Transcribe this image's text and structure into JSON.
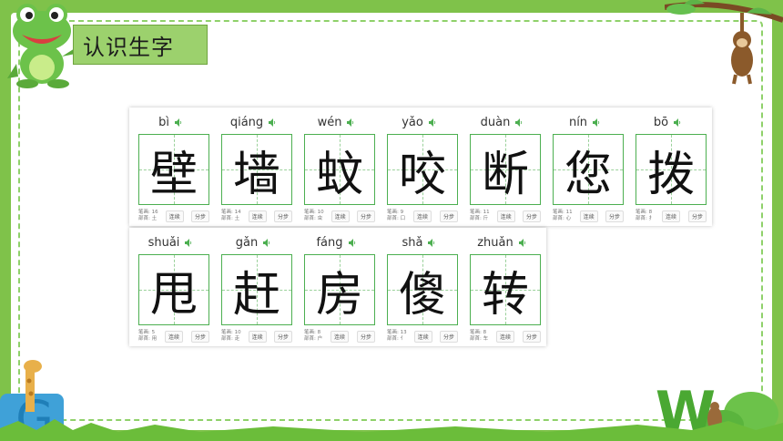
{
  "header": {
    "title": "认识生字"
  },
  "colors": {
    "accent": "#4caf50",
    "banner": "#9cd16d",
    "background": "#7fc24a"
  },
  "buttons": {
    "continuous": "连续",
    "step": "分步"
  },
  "rows": [
    [
      {
        "pinyin": "bì",
        "char": "壁",
        "strokes": "笔画: 16",
        "radical": "部首: 土"
      },
      {
        "pinyin": "qiáng",
        "char": "墙",
        "strokes": "笔画: 14",
        "radical": "部首: 土"
      },
      {
        "pinyin": "wén",
        "char": "蚊",
        "strokes": "笔画: 10",
        "radical": "部首: 虫"
      },
      {
        "pinyin": "yǎo",
        "char": "咬",
        "strokes": "笔画: 9",
        "radical": "部首: 口"
      },
      {
        "pinyin": "duàn",
        "char": "断",
        "strokes": "笔画: 11",
        "radical": "部首: 斤"
      },
      {
        "pinyin": "nín",
        "char": "您",
        "strokes": "笔画: 11",
        "radical": "部首: 心"
      },
      {
        "pinyin": "bō",
        "char": "拨",
        "strokes": "笔画: 8",
        "radical": "部首: 扌"
      }
    ],
    [
      {
        "pinyin": "shuǎi",
        "char": "甩",
        "strokes": "笔画: 5",
        "radical": "部首: 用"
      },
      {
        "pinyin": "gǎn",
        "char": "赶",
        "strokes": "笔画: 10",
        "radical": "部首: 走"
      },
      {
        "pinyin": "fáng",
        "char": "房",
        "strokes": "笔画: 8",
        "radical": "部首: 户"
      },
      {
        "pinyin": "shǎ",
        "char": "傻",
        "strokes": "笔画: 13",
        "radical": "部首: 亻"
      },
      {
        "pinyin": "zhuǎn",
        "char": "转",
        "strokes": "笔画: 8",
        "radical": "部首: 车"
      }
    ]
  ]
}
